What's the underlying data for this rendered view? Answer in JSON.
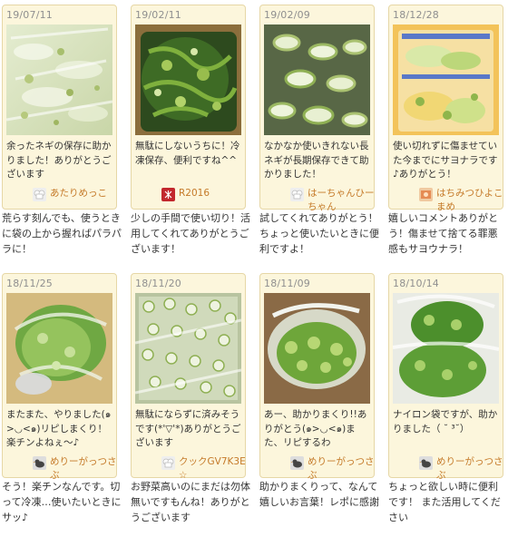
{
  "entries": [
    {
      "date": "19/07/11",
      "photo_icon": "sliced-green-onion-bag-photo",
      "message": "余ったネギの保存に助かりました！ありがとうございます",
      "user": "あたりめっこ",
      "avatar_icon": "chef-hat-avatar",
      "reply": "荒らす刻んでも、使うときに袋の上から握ればパラパラに！"
    },
    {
      "date": "19/02/11",
      "photo_icon": "green-onion-container-photo",
      "message": "無駄にしないうちに！冷凍保存、便利ですね^^",
      "user": "R2016",
      "avatar_icon": "red-stamp-avatar",
      "reply": "少しの手間で使い切り！活用してくれてありがとうございます！"
    },
    {
      "date": "19/02/09",
      "photo_icon": "sliced-leek-photo",
      "message": "なかなか使いきれない長ネギが長期保存できて助かりました！",
      "user": "はーちゃんひーちゃん",
      "avatar_icon": "chef-hat-avatar",
      "reply": "試してくれてありがとう！ちょっと使いたいときに便利ですよ！"
    },
    {
      "date": "18/12/28",
      "photo_icon": "frozen-onion-ziploc-photo",
      "message": "使い切れずに傷ませていた今までにサヨナラです♪ありがとう！",
      "user": "はちみつひよこまめ",
      "avatar_icon": "photo-avatar",
      "reply": "嬉しいコメントありがとう！傷ませて捨てる罪悪感もサヨウナラ！"
    },
    {
      "date": "18/11/25",
      "photo_icon": "green-onion-plastic-bag-photo",
      "message": "またまた、やりました(๑>◡<๑)リピしまくり！楽チンよねぇ～♪",
      "user": "めりーがっつさぶ",
      "avatar_icon": "bird-avatar",
      "reply": "そう！楽チンなんです。切って冷凍…使いたいときにサッ♪"
    },
    {
      "date": "18/11/20",
      "photo_icon": "chopped-onion-bag-photo",
      "message": "無駄にならずに済みそうです(*'▽'*)ありがとうございます",
      "user": "クックGV7K3E☆",
      "avatar_icon": "chef-hat-avatar",
      "reply": "お野菜高いのにまだは勿体無いですもんね！ありがとうございます"
    },
    {
      "date": "18/11/09",
      "photo_icon": "green-onion-bag-photo",
      "message": "あー、助かりまくり!!ありがとう(๑>◡<๑)また、リピするわ",
      "user": "めりーがっつさぶ",
      "avatar_icon": "bird-avatar",
      "reply": "助かりまくりって、なんて嬉しいお言葉！レポに感謝"
    },
    {
      "date": "18/10/14",
      "photo_icon": "nylon-bag-green-onion-photo",
      "message": "ナイロン袋ですが、助かりました（ ˘ ³˘）",
      "user": "めりーがっつさぶ",
      "avatar_icon": "bird-avatar",
      "reply": "ちょっと欲しい時に便利です！ また活用してください"
    }
  ],
  "colors": {
    "card_bg": "#fcf6dc",
    "card_border": "#e6d7a6",
    "date_text": "#8f8f8f",
    "username": "#c57a29",
    "body_text": "#333333"
  }
}
